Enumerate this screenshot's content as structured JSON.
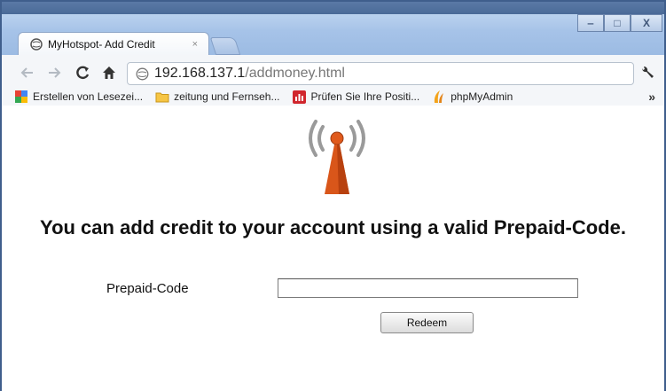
{
  "tab": {
    "title": "MyHotspot- Add Credit",
    "close": "×"
  },
  "window_controls": {
    "minimize": "‒",
    "maximize": "□",
    "close": "X"
  },
  "address": {
    "host": "192.168.137.1",
    "path": "/addmoney.html"
  },
  "bookmarks": [
    {
      "label": "Erstellen von Lesezei...",
      "icon": "google-bookmark-icon"
    },
    {
      "label": "zeitung und Fernseh...",
      "icon": "folder-icon"
    },
    {
      "label": "Prüfen Sie Ihre Positi...",
      "icon": "chart-icon"
    },
    {
      "label": "phpMyAdmin",
      "icon": "phpmyadmin-icon"
    }
  ],
  "bookmarks_overflow": "»",
  "page": {
    "headline": "You can add credit to your account using a valid Prepaid-Code.",
    "field_label": "Prepaid-Code",
    "field_value": "",
    "button_label": "Redeem"
  },
  "colors": {
    "title_bar": "#a6c3e8",
    "logo": "#d9561a"
  }
}
